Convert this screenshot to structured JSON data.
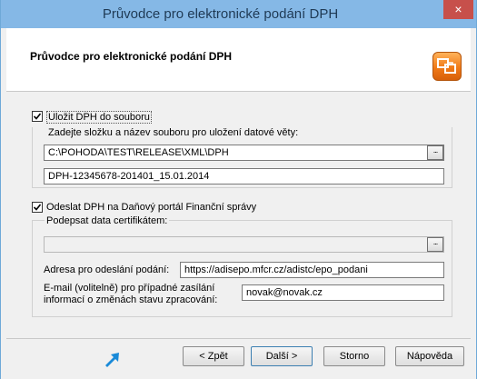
{
  "window": {
    "title": "Průvodce pro elektronické podání DPH",
    "close_glyph": "×"
  },
  "header": {
    "title": "Průvodce pro elektronické podání DPH",
    "icon": "wizard-icon"
  },
  "save_section": {
    "checkbox_label": "Uložit DPH do souboru",
    "checked": true,
    "group_label": "Zadejte složku a název souboru pro uložení datové věty:",
    "folder_value": "C:\\POHODA\\TEST\\RELEASE\\XML\\DPH",
    "filename_value": "DPH-12345678-201401_15.01.2014",
    "browse_label": "..."
  },
  "send_section": {
    "checkbox_label": "Odeslat DPH na Daňový portál Finanční správy",
    "checked": true,
    "sign_label": "Podepsat data certifikátem:",
    "certificate_value": "",
    "browse_label": "...",
    "address_label": "Adresa pro odeslání podání:",
    "address_value": "https://adisepo.mfcr.cz/adistc/epo_podani",
    "email_label_line1": "E-mail (volitelně) pro případné zasílání",
    "email_label_line2": "informací o změnách stavu zpracování:",
    "email_value": "novak@novak.cz"
  },
  "buttons": {
    "back": "< Zpět",
    "next": "Další >",
    "cancel": "Storno",
    "help": "Nápověda"
  },
  "colors": {
    "titlebar": "#85b8e6",
    "close": "#c7504b",
    "accent": "#3c7fb1"
  }
}
